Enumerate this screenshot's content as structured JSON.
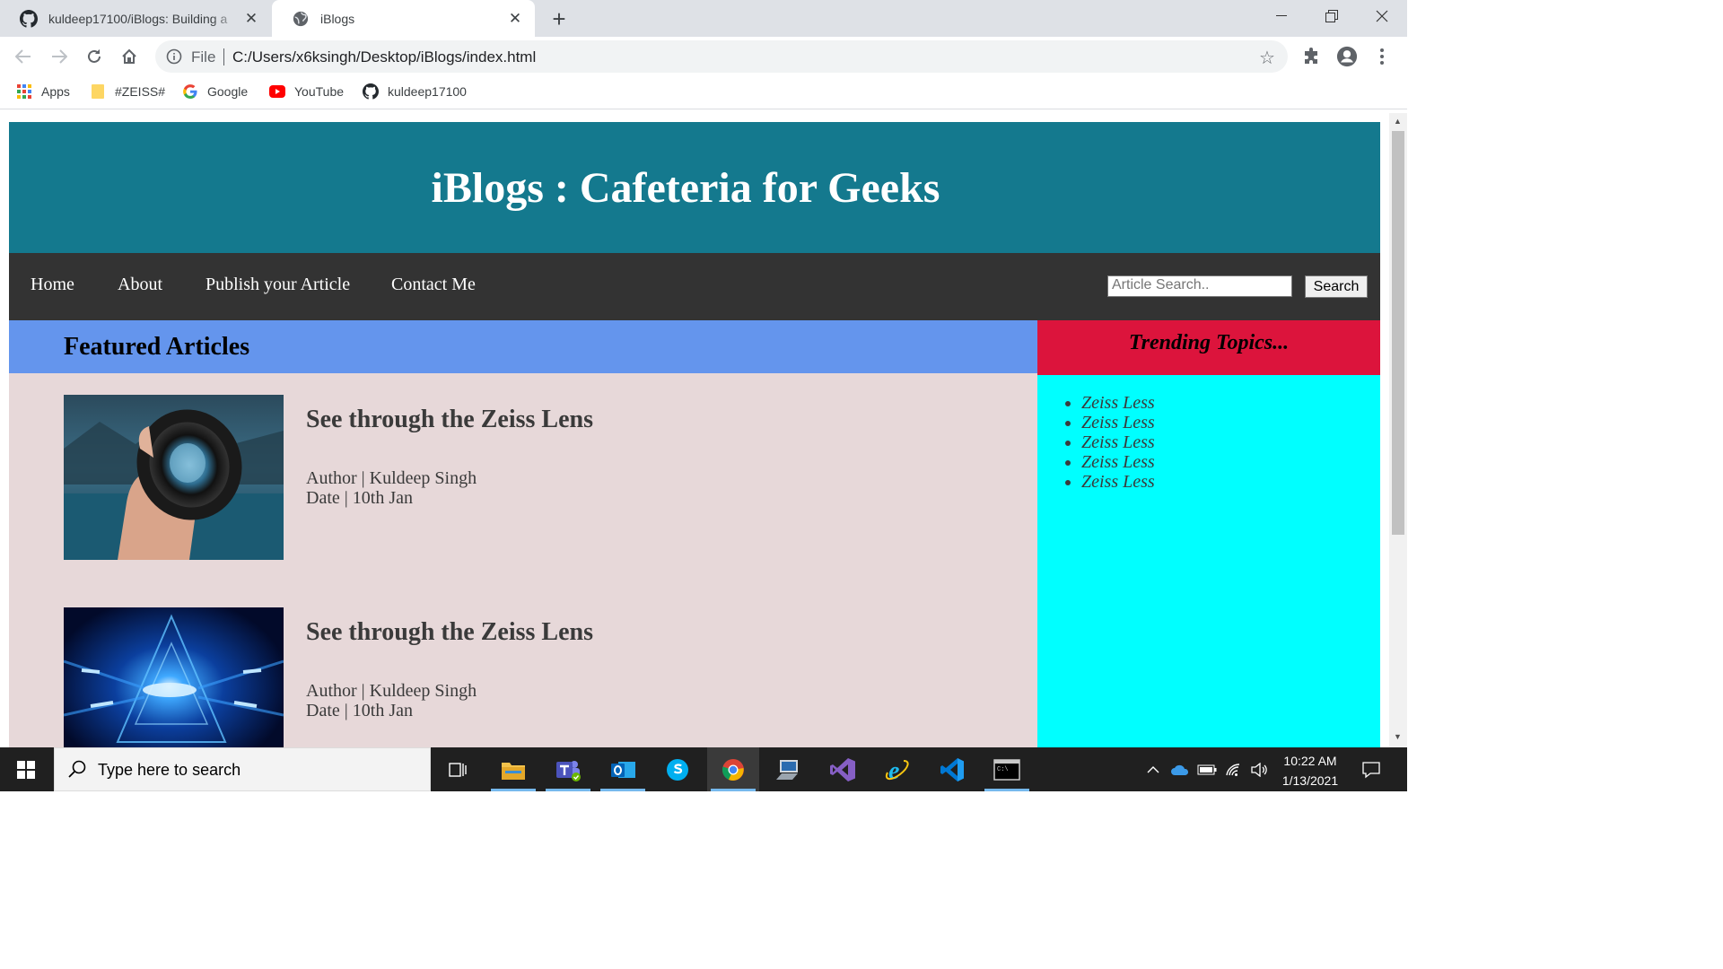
{
  "browser": {
    "tabs": [
      {
        "title": "kuldeep17100/iBlogs: Building a",
        "favicon": "github-icon",
        "active": false
      },
      {
        "title": "iBlogs",
        "favicon": "globe-icon",
        "active": true
      }
    ],
    "address": {
      "scheme_label": "File",
      "url": "C:/Users/x6ksingh/Desktop/iBlogs/index.html"
    },
    "bookmarks": [
      {
        "label": "Apps",
        "icon": "apps-grid-icon"
      },
      {
        "label": "#ZEISS#",
        "icon": "folder-icon"
      },
      {
        "label": "Google",
        "icon": "google-icon"
      },
      {
        "label": "YouTube",
        "icon": "youtube-icon"
      },
      {
        "label": "kuldeep17100",
        "icon": "github-icon"
      }
    ]
  },
  "site": {
    "title": "iBlogs : Cafeteria for Geeks",
    "nav": [
      "Home",
      "About",
      "Publish your Article",
      "Contact Me"
    ],
    "search": {
      "placeholder": "Article Search..",
      "button": "Search"
    },
    "featured_heading": "Featured Articles",
    "articles": [
      {
        "title": "See through the Zeiss Lens",
        "author": "Author | Kuldeep Singh",
        "date": "Date | 10th Jan",
        "image": "hand-holding-lens-photo"
      },
      {
        "title": "See through the Zeiss Lens",
        "author": "Author | Kuldeep Singh",
        "date": "Date | 10th Jan",
        "image": "blue-tech-tunnel-photo"
      }
    ],
    "trending_heading": "Trending Topics...",
    "trending": [
      "Zeiss Less",
      "Zeiss Less",
      "Zeiss Less",
      "Zeiss Less",
      "Zeiss Less"
    ],
    "colors": {
      "header": "#14798e",
      "nav": "#333333",
      "featured_bar": "#6495ed",
      "main_bg": "#e7d8d9",
      "trending_bar": "#dc143c",
      "sidebar_bg": "#00ffff"
    }
  },
  "taskbar": {
    "search_placeholder": "Type here to search",
    "time": "10:22 AM",
    "date": "1/13/2021"
  }
}
